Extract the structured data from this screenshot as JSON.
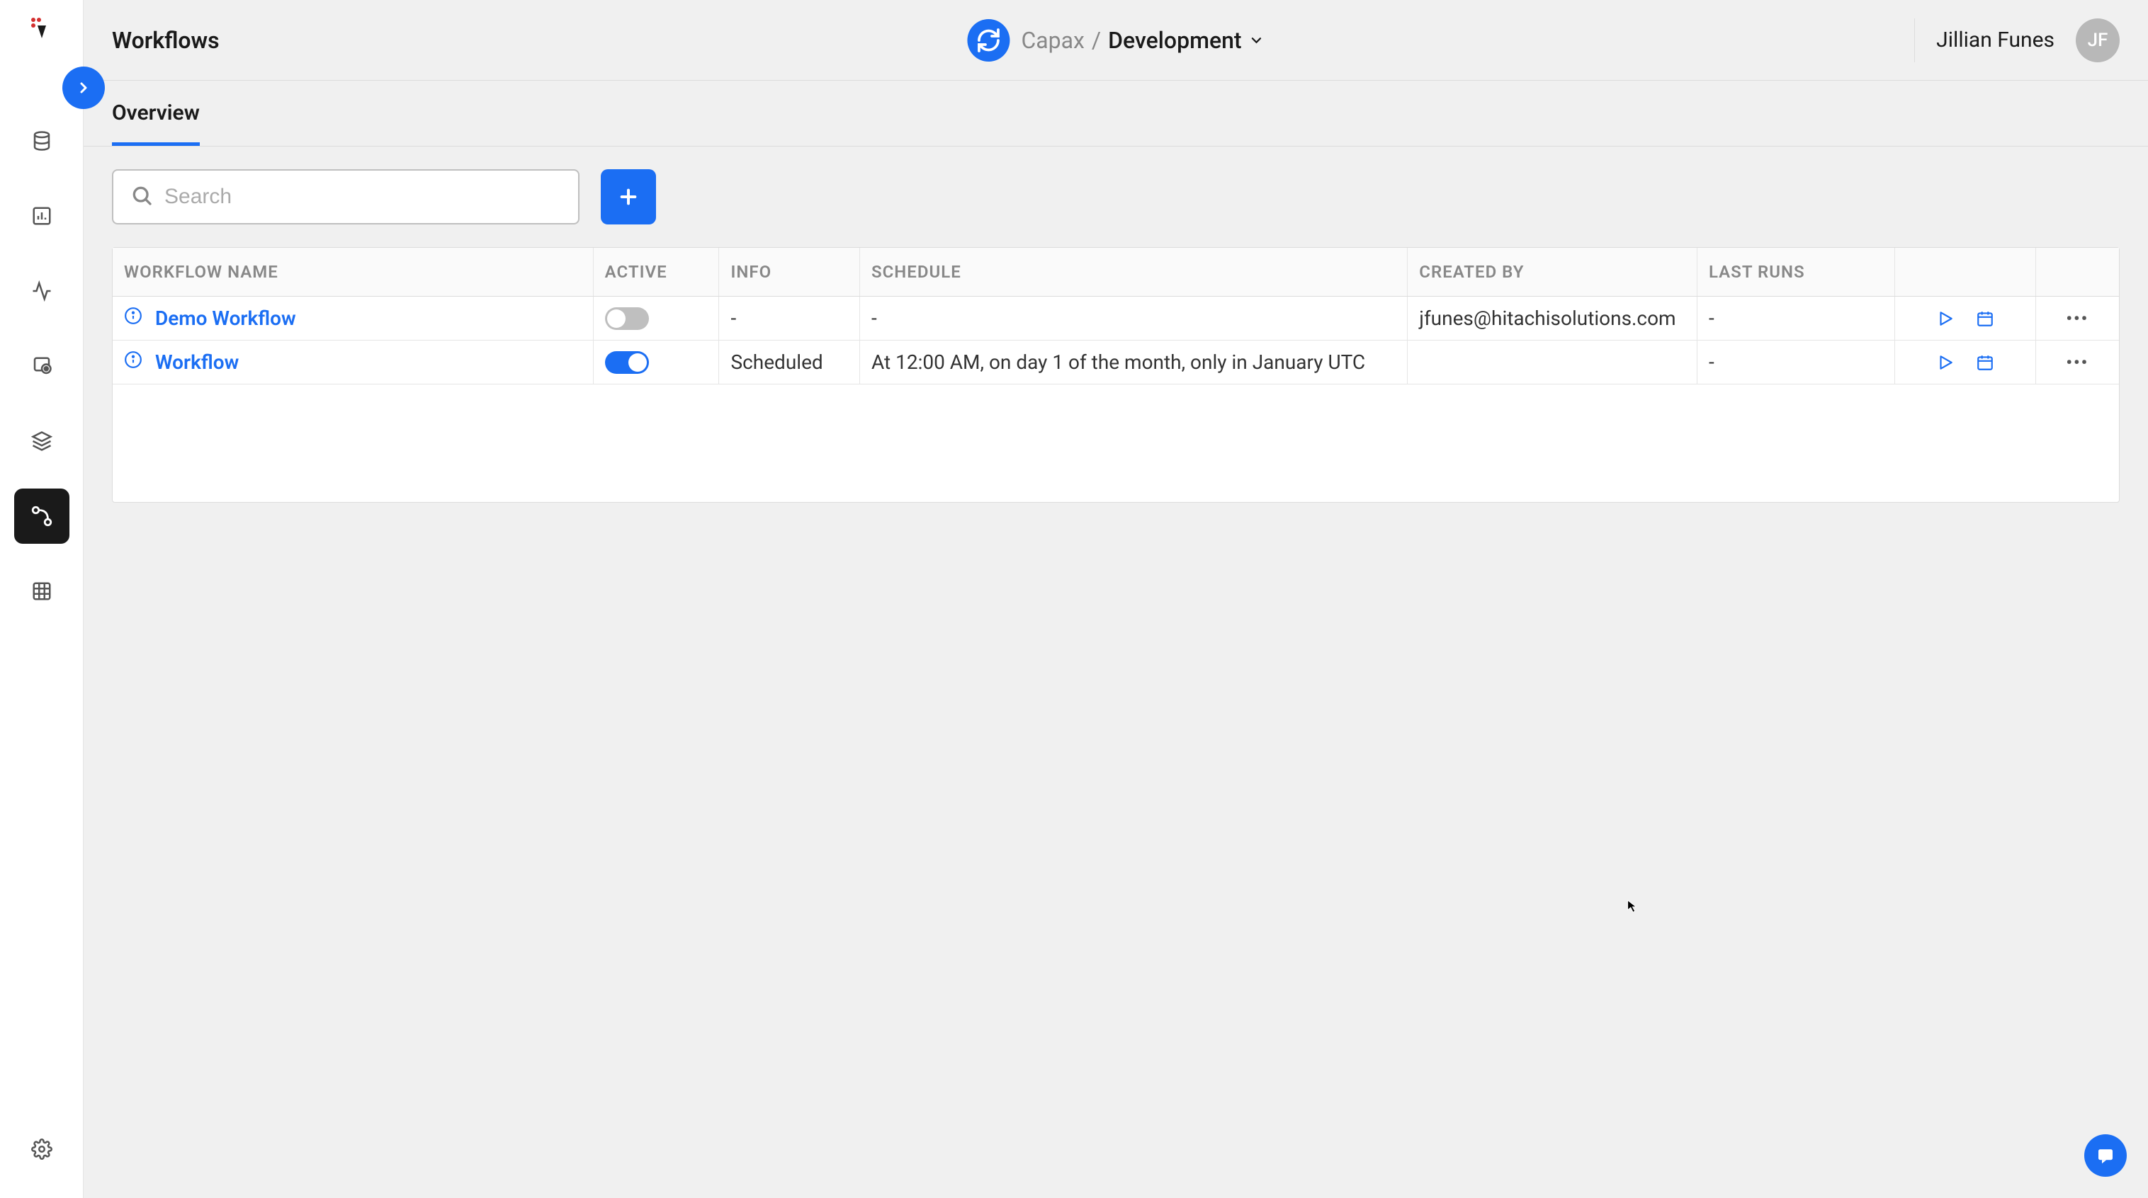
{
  "header": {
    "title": "Workflows",
    "breadcrumb_org": "Capax",
    "breadcrumb_sep": "/",
    "breadcrumb_env": "Development",
    "user_name": "Jillian Funes",
    "user_initials": "JF"
  },
  "tabs": {
    "overview": "Overview"
  },
  "toolbar": {
    "search_placeholder": "Search"
  },
  "table": {
    "headers": {
      "name": "Workflow Name",
      "active": "Active",
      "info": "Info",
      "schedule": "Schedule",
      "created_by": "Created By",
      "last_runs": "Last Runs"
    },
    "rows": [
      {
        "name": "Demo Workflow",
        "active": false,
        "info": "-",
        "schedule": "-",
        "created_by": "jfunes@hitachisolutions.com",
        "last_runs": "-"
      },
      {
        "name": "Workflow",
        "active": true,
        "info": "Scheduled",
        "schedule": "At 12:00 AM, on day 1 of the month, only in January UTC",
        "created_by": "",
        "last_runs": "-"
      }
    ]
  }
}
